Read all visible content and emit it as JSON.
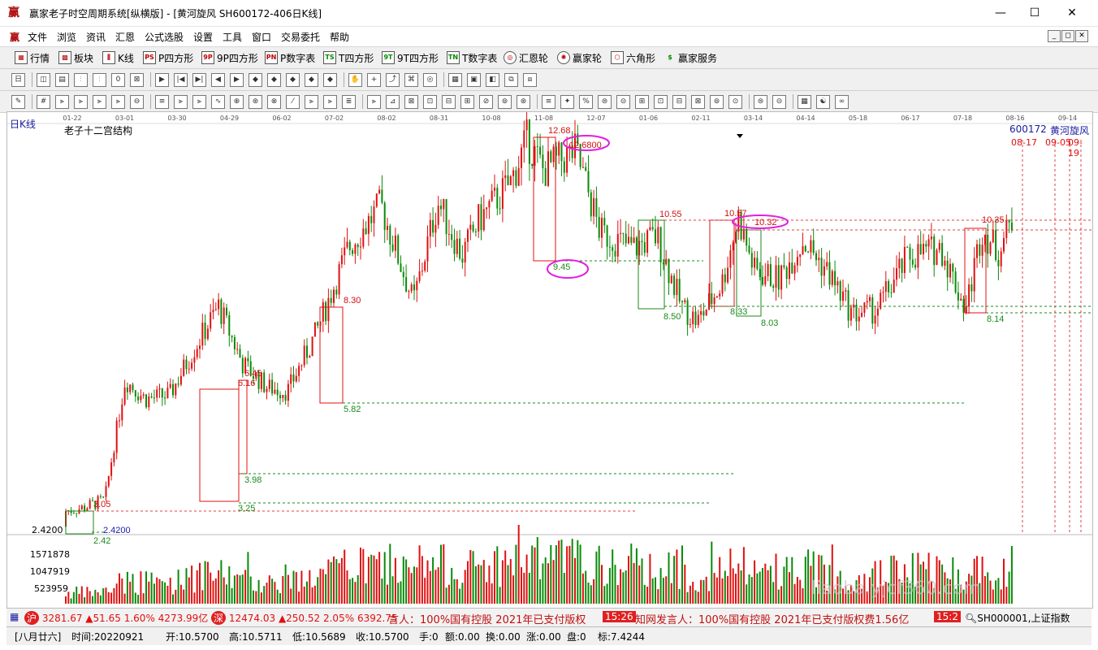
{
  "window": {
    "title": "赢家老子时空周期系统[纵横版] - [黄河旋风  SH600172-406日K线]",
    "minimize": "—",
    "maximize": "☐",
    "close": "✕"
  },
  "menu": [
    "文件",
    "浏览",
    "资讯",
    "汇恩",
    "公式选股",
    "设置",
    "工具",
    "窗口",
    "交易委托",
    "帮助"
  ],
  "mdi_controls": [
    "_",
    "◻",
    "✕"
  ],
  "toolbar1": [
    "行情",
    "板块",
    "K线",
    "P四方形",
    "9P四方形",
    "P数字表",
    "T四方形",
    "9T四方形",
    "T数字表",
    "汇恩轮",
    "赢家轮",
    "六角形",
    "赢家服务"
  ],
  "toolbar1_icons": [
    "grid-icon",
    "blocks-icon",
    "kline-icon",
    "ps-icon",
    "9p-icon",
    "pn-icon",
    "ts-icon",
    "9t-icon",
    "tn-icon",
    "circle-icon",
    "wheel-icon",
    "hexagon-icon",
    "dollar-icon"
  ],
  "chart": {
    "period_label": "日K线",
    "structure_label": "老子十二宫结构",
    "stock_code": "600172",
    "stock_name": "黄河旋风",
    "date_marker": "08-17",
    "date_marker2": "09-05",
    "date_marker3": "09-19",
    "top_dates": [
      "01-22",
      "03-01",
      "03-30",
      "04-29",
      "06-02",
      "07-02",
      "08-02",
      "08-31",
      "10-08",
      "11-08",
      "12-07",
      "01-06",
      "02-11",
      "03-14",
      "04-14",
      "05-18",
      "06-17",
      "07-18",
      "08-16",
      "09-14"
    ],
    "price_left_label": "2.4200",
    "volume_ticks": [
      "1571878",
      "1047919",
      "523959"
    ],
    "annotations": [
      {
        "text": "12.68",
        "color": "red"
      },
      {
        "text": "12.6800",
        "color": "red"
      },
      {
        "text": "9.45",
        "color": "green"
      },
      {
        "text": "10.55",
        "color": "red"
      },
      {
        "text": "10.57",
        "color": "red"
      },
      {
        "text": "10.32",
        "color": "red"
      },
      {
        "text": "10.35",
        "color": "red"
      },
      {
        "text": "8.30",
        "color": "red"
      },
      {
        "text": "5.82",
        "color": "green"
      },
      {
        "text": "6.45",
        "color": "red"
      },
      {
        "text": "6.16",
        "color": "red"
      },
      {
        "text": "3.98",
        "color": "green"
      },
      {
        "text": "3.25",
        "color": "green"
      },
      {
        "text": "3.05",
        "color": "red"
      },
      {
        "text": "2.42",
        "color": "green"
      },
      {
        "text": "2.4200",
        "color": "blue"
      },
      {
        "text": "8.50",
        "color": "green"
      },
      {
        "text": "8.33",
        "color": "green"
      },
      {
        "text": "8.03",
        "color": "green"
      },
      {
        "text": "8.14",
        "color": "green"
      }
    ]
  },
  "status": {
    "sh_index": "3281.67",
    "sh_change": "▲51.65",
    "sh_pct": "1.60%",
    "sh_amount": "4273.99亿",
    "sz_index": "12474.03",
    "sz_change": "▲250.52",
    "sz_pct": "2.05%",
    "sz_amount": "6392.75",
    "news1": "言人：100%国有控股 2021年已支付版权",
    "news_time": "15:26",
    "news2": "知网发言人：100%国有控股 2021年已支付版权费1.56亿",
    "news_time2": "15:2",
    "index_code": "SH000001,上证指数"
  },
  "info": {
    "lunar": "[八月廿六]",
    "time": "时间:20220921",
    "open": "开:10.5700",
    "high": "高:10.5711",
    "low": "低:10.5689",
    "close": "收:10.5700",
    "hands": "手:0",
    "amount": "额:0.00",
    "turnover": "换:0.00",
    "change": "涨:0.00",
    "pan": "盘:0",
    "mark": "标:7.4244"
  },
  "watermark": "liaoba.yjcf360.com",
  "colors": {
    "up": "#e01010",
    "down": "#0a8a0a",
    "dashred": "#e04040",
    "dashgreen": "#1a8a1a",
    "magenta": "#e020e0"
  }
}
